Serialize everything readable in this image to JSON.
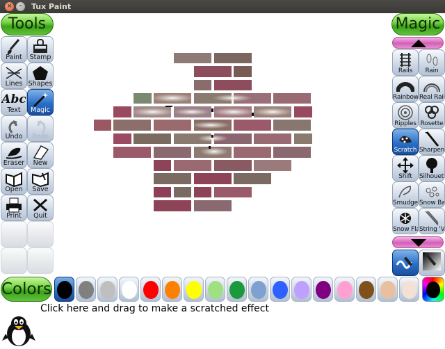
{
  "window": {
    "title": "Tux Paint"
  },
  "tools_header": "Tools",
  "magic_header": "Magic",
  "colors_header": "Colors",
  "tools": [
    {
      "label": "Paint",
      "icon": "paintbrush-icon",
      "state": "normal"
    },
    {
      "label": "Stamp",
      "icon": "stamp-icon",
      "state": "normal"
    },
    {
      "label": "Lines",
      "icon": "lines-icon",
      "state": "normal"
    },
    {
      "label": "Shapes",
      "icon": "pentagon-icon",
      "state": "normal"
    },
    {
      "label": "Text",
      "icon": "text-abc-icon",
      "glyph": "Abc",
      "state": "normal"
    },
    {
      "label": "Magic",
      "icon": "magic-wand-icon",
      "state": "selected"
    },
    {
      "label": "Undo",
      "icon": "undo-icon",
      "state": "normal"
    },
    {
      "label": "Redo",
      "icon": "redo-icon",
      "state": "disabled"
    },
    {
      "label": "Eraser",
      "icon": "eraser-icon",
      "state": "normal"
    },
    {
      "label": "New",
      "icon": "new-page-icon",
      "state": "normal"
    },
    {
      "label": "Open",
      "icon": "open-book-icon",
      "state": "normal"
    },
    {
      "label": "Save",
      "icon": "save-book-icon",
      "state": "normal"
    },
    {
      "label": "Print",
      "icon": "printer-icon",
      "state": "normal"
    },
    {
      "label": "Quit",
      "icon": "quit-x-icon",
      "state": "normal"
    }
  ],
  "magic": [
    {
      "label": "Rails",
      "icon": "rails-icon",
      "state": "normal"
    },
    {
      "label": "Rain",
      "icon": "rain-icon",
      "state": "normal"
    },
    {
      "label": "Rainbow",
      "icon": "rainbow-icon",
      "state": "normal"
    },
    {
      "label": "Real Rainbow",
      "icon": "real-rainbow-icon",
      "state": "normal"
    },
    {
      "label": "Ripples",
      "icon": "ripples-icon",
      "state": "normal"
    },
    {
      "label": "Rosette",
      "icon": "rosette-icon",
      "state": "normal"
    },
    {
      "label": "Scratch",
      "icon": "scratch-icon",
      "state": "selected"
    },
    {
      "label": "Sharpen",
      "icon": "sharpen-icon",
      "state": "normal"
    },
    {
      "label": "Shift",
      "icon": "shift-arrows-icon",
      "state": "normal"
    },
    {
      "label": "Silhouette",
      "icon": "silhouette-tree-icon",
      "state": "normal"
    },
    {
      "label": "Smudge",
      "icon": "smudge-icon",
      "state": "normal"
    },
    {
      "label": "Snow Ball",
      "icon": "snowball-icon",
      "state": "normal"
    },
    {
      "label": "Snow Flake",
      "icon": "snowflake-icon",
      "state": "normal"
    },
    {
      "label": "String 'V'",
      "icon": "string-v-icon",
      "state": "normal"
    }
  ],
  "colors": [
    {
      "name": "black",
      "hex": "#000000",
      "selected": true
    },
    {
      "name": "dark-gray",
      "hex": "#808080"
    },
    {
      "name": "light-gray",
      "hex": "#bfbfbf"
    },
    {
      "name": "white",
      "hex": "#ffffff"
    },
    {
      "name": "red",
      "hex": "#ff0000"
    },
    {
      "name": "orange",
      "hex": "#ff8000"
    },
    {
      "name": "yellow",
      "hex": "#ffff00"
    },
    {
      "name": "light-green",
      "hex": "#a0e080"
    },
    {
      "name": "dark-green",
      "hex": "#1a9a3c"
    },
    {
      "name": "sky-blue",
      "hex": "#80a0d0"
    },
    {
      "name": "blue",
      "hex": "#3060ff"
    },
    {
      "name": "lavender",
      "hex": "#c0a0ff"
    },
    {
      "name": "purple",
      "hex": "#800080"
    },
    {
      "name": "pink",
      "hex": "#ffa0d0"
    },
    {
      "name": "brown",
      "hex": "#80501a"
    },
    {
      "name": "tan",
      "hex": "#e8c0a0"
    },
    {
      "name": "beige",
      "hex": "#f4e0d4"
    }
  ],
  "status_text": "Click here and drag to make a scratched effect"
}
